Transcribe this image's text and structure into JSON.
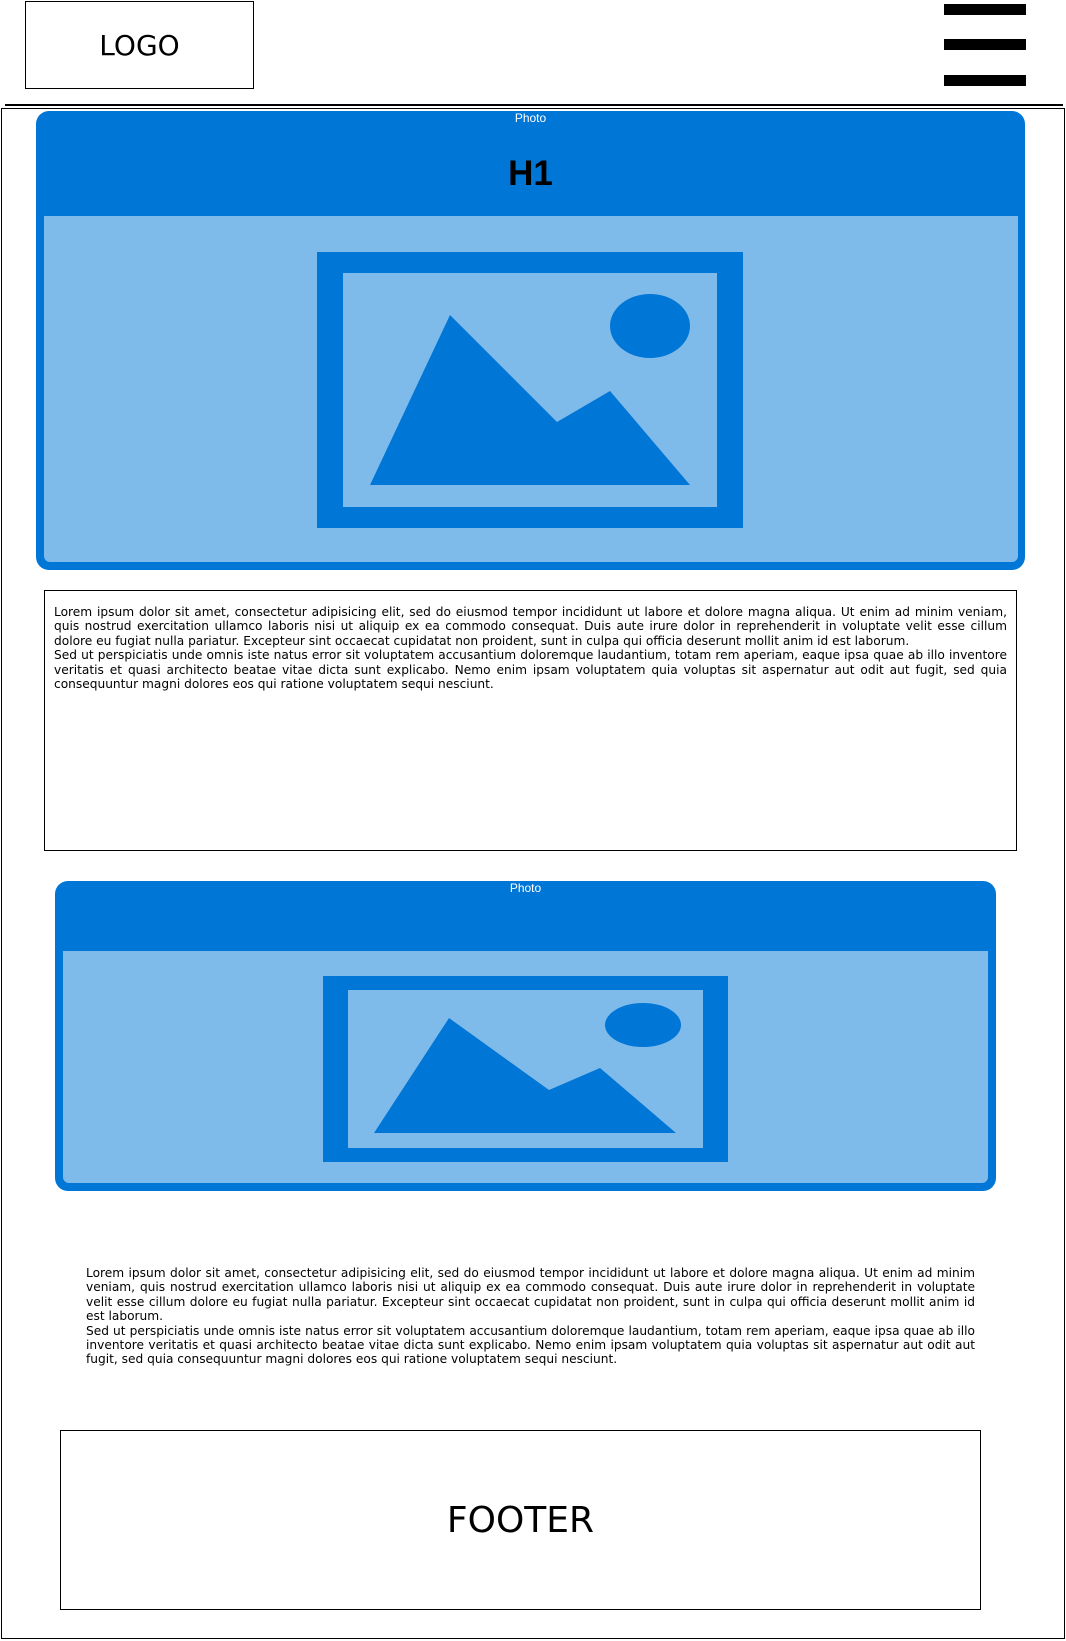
{
  "header": {
    "logo": "LOGO",
    "menu_icon": "hamburger-menu-icon"
  },
  "hero": {
    "photo_caption": "Photo",
    "title": "H1",
    "image_icon": "image-placeholder-icon"
  },
  "section_one": {
    "paragraphs": [
      "Lorem ipsum dolor sit amet, consectetur adipisicing elit, sed do eiusmod tempor incididunt ut labore et dolore magna aliqua. Ut enim ad minim veniam, quis nostrud exercitation ullamco laboris nisi ut aliquip ex ea commodo consequat. Duis aute irure dolor in reprehenderit in voluptate velit esse cillum dolore eu fugiat nulla pariatur. Excepteur sint occaecat cupidatat non proident, sunt in culpa qui officia deserunt mollit anim id est laborum.",
      "Sed ut perspiciatis unde omnis iste natus error sit voluptatem accusantium doloremque laudantium, totam rem aperiam, eaque ipsa quae ab illo inventore veritatis et quasi architecto beatae vitae dicta sunt explicabo. Nemo enim ipsam voluptatem quia voluptas sit aspernatur aut odit aut fugit, sed quia consequuntur magni dolores eos qui ratione voluptatem sequi nesciunt."
    ]
  },
  "second_photo": {
    "photo_caption": "Photo",
    "image_icon": "image-placeholder-icon"
  },
  "section_two": {
    "paragraphs": [
      "Lorem ipsum dolor sit amet, consectetur adipisicing elit, sed do eiusmod tempor incididunt ut labore et dolore magna aliqua. Ut enim ad minim veniam, quis nostrud exercitation ullamco laboris nisi ut aliquip ex ea commodo consequat. Duis aute irure dolor in reprehenderit in voluptate velit esse cillum dolore eu fugiat nulla pariatur. Excepteur sint occaecat cupidatat non proident, sunt in culpa qui officia deserunt mollit anim id est laborum.",
      "Sed ut perspiciatis unde omnis iste natus error sit voluptatem accusantium doloremque laudantium, totam rem aperiam, eaque ipsa quae ab illo inventore veritatis et quasi architecto beatae vitae dicta sunt explicabo. Nemo enim ipsam voluptatem quia voluptas sit aspernatur aut odit aut fugit, sed quia consequuntur magni dolores eos qui ratione voluptatem sequi nesciunt."
    ]
  },
  "footer": {
    "label": "FOOTER"
  },
  "colors": {
    "photo_frame": "#0076d6",
    "photo_inner": "#7fbbea",
    "caption_text": "#ffffff"
  }
}
